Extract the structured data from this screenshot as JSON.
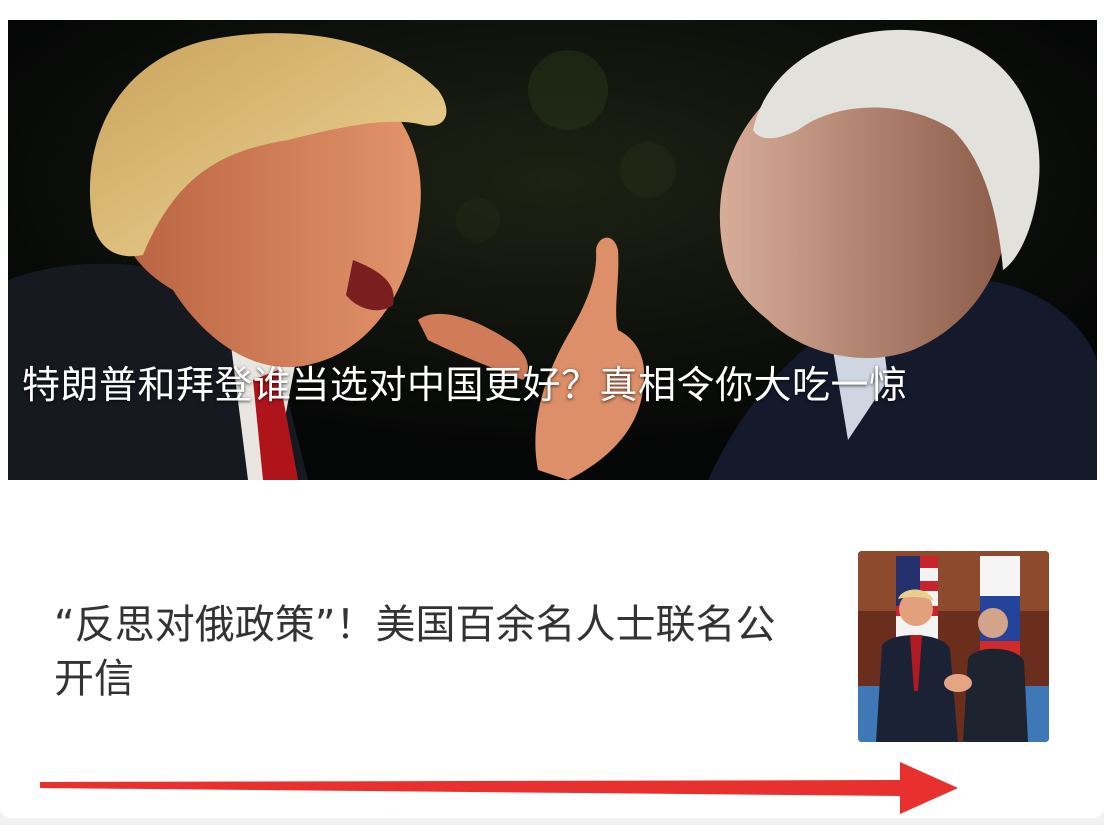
{
  "feed": {
    "hero": {
      "title": "特朗普和拜登谁当选对中国更好？真相令你大吃一惊",
      "image": "photo-two-men-arguing"
    },
    "items": [
      {
        "title": "“反思对俄政策”！美国百余名人士联名公开信",
        "thumbnail": "photo-two-leaders-handshake"
      }
    ]
  },
  "annotation": {
    "arrow_color": "#e8312f",
    "arrow_direction": "right"
  }
}
